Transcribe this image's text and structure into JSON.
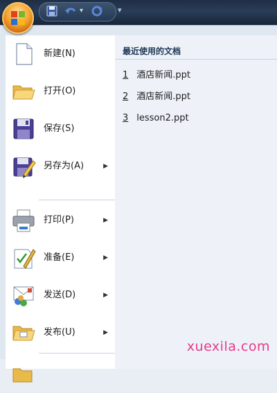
{
  "quick_access": {
    "items": [
      "save-icon",
      "undo-icon",
      "undo-dropdown-icon",
      "redo-icon"
    ],
    "customize_glyph": "▾"
  },
  "menu": {
    "items": [
      {
        "label": "新建(N)",
        "icon": "new-document-icon",
        "has_submenu": false
      },
      {
        "label": "打开(O)",
        "icon": "open-folder-icon",
        "has_submenu": false
      },
      {
        "label": "保存(S)",
        "icon": "save-disk-icon",
        "has_submenu": false
      },
      {
        "label": "另存为(A)",
        "icon": "save-as-icon",
        "has_submenu": true
      },
      {
        "label": "打印(P)",
        "icon": "printer-icon",
        "has_submenu": true
      },
      {
        "label": "准备(E)",
        "icon": "prepare-icon",
        "has_submenu": true
      },
      {
        "label": "发送(D)",
        "icon": "send-icon",
        "has_submenu": true
      },
      {
        "label": "发布(U)",
        "icon": "publish-icon",
        "has_submenu": true
      }
    ],
    "submenu_arrow": "▶"
  },
  "recent": {
    "title": "最近使用的文档",
    "items": [
      {
        "num": "1",
        "name": "酒店新闻.ppt"
      },
      {
        "num": "2",
        "name": "酒店新闻.ppt"
      },
      {
        "num": "3",
        "name": "lesson2.ppt"
      }
    ]
  },
  "watermark": "xuexila.com",
  "colors": {
    "title_bar": "#1e2e44",
    "orb": "#f2a12d",
    "menu_background": "#dfe7f1",
    "watermark": "#e63a8a"
  }
}
